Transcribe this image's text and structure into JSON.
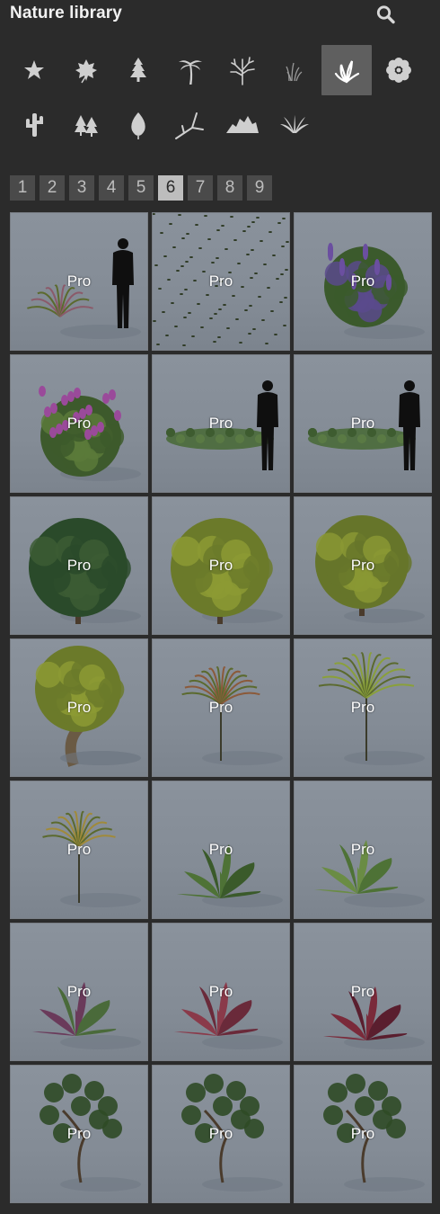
{
  "header": {
    "title": "Nature library",
    "search_icon": "search-icon"
  },
  "categories": [
    {
      "icon": "star-icon",
      "active": false
    },
    {
      "icon": "maple-leaf-icon",
      "active": false
    },
    {
      "icon": "pine-tree-icon",
      "active": false
    },
    {
      "icon": "palm-tree-icon",
      "active": false
    },
    {
      "icon": "bare-tree-icon",
      "active": false
    },
    {
      "icon": "grass-icon",
      "active": false
    },
    {
      "icon": "plant-leaves-icon",
      "active": true
    },
    {
      "icon": "flower-icon",
      "active": false
    },
    {
      "icon": "cactus-icon",
      "active": false
    },
    {
      "icon": "forest-icon",
      "active": false
    },
    {
      "icon": "leaf-icon",
      "active": false
    },
    {
      "icon": "branch-icon",
      "active": false
    },
    {
      "icon": "rocks-icon",
      "active": false
    },
    {
      "icon": "fern-icon",
      "active": false
    }
  ],
  "pagination": {
    "pages": [
      "1",
      "2",
      "3",
      "4",
      "5",
      "6",
      "7",
      "8",
      "9"
    ],
    "current": "6"
  },
  "items": [
    {
      "badge": "Pro",
      "thumb": "grass-with-person"
    },
    {
      "badge": "Pro",
      "thumb": "scattered-leaves"
    },
    {
      "badge": "Pro",
      "thumb": "lavender-bush"
    },
    {
      "badge": "Pro",
      "thumb": "pink-flower-bush"
    },
    {
      "badge": "Pro",
      "thumb": "groundcover-with-person"
    },
    {
      "badge": "Pro",
      "thumb": "groundcover-with-person"
    },
    {
      "badge": "Pro",
      "thumb": "dark-green-shrub"
    },
    {
      "badge": "Pro",
      "thumb": "yellow-green-shrub"
    },
    {
      "badge": "Pro",
      "thumb": "yellow-green-tree"
    },
    {
      "badge": "Pro",
      "thumb": "bonsai-tree"
    },
    {
      "badge": "Pro",
      "thumb": "dracaena-red"
    },
    {
      "badge": "Pro",
      "thumb": "dracaena-green"
    },
    {
      "badge": "Pro",
      "thumb": "dracaena-yellow"
    },
    {
      "badge": "Pro",
      "thumb": "broadleaf-plant"
    },
    {
      "badge": "Pro",
      "thumb": "banana-plant"
    },
    {
      "badge": "Pro",
      "thumb": "coleus-green"
    },
    {
      "badge": "Pro",
      "thumb": "coleus-red"
    },
    {
      "badge": "Pro",
      "thumb": "caladium-red"
    },
    {
      "badge": "Pro",
      "thumb": "small-tree"
    },
    {
      "badge": "Pro",
      "thumb": "small-tree"
    },
    {
      "badge": "Pro",
      "thumb": "spreading-tree"
    }
  ]
}
